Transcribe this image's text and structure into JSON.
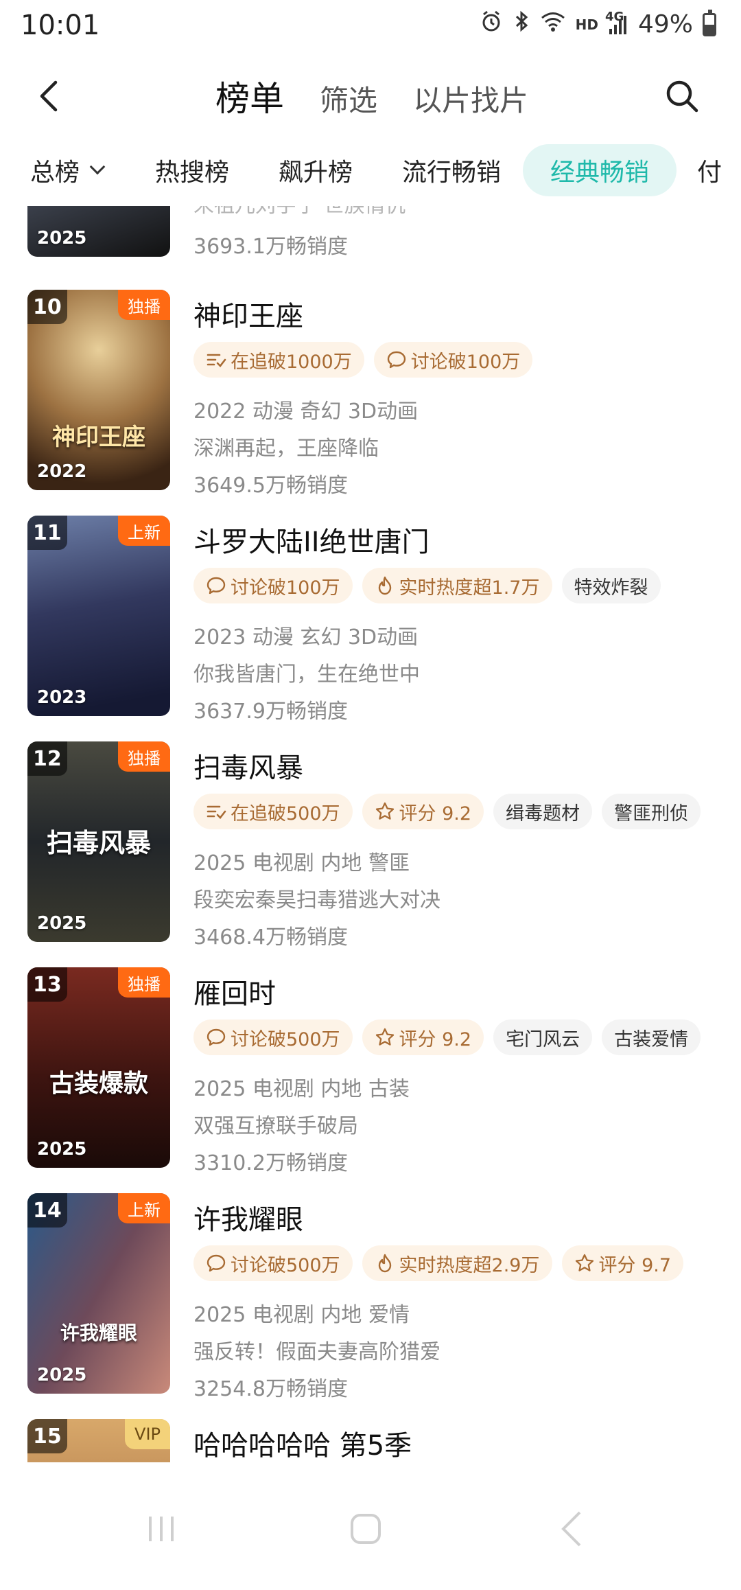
{
  "status": {
    "time": "10:01",
    "hd": "HD",
    "network": "4G",
    "battery": "49%",
    "battery_level": 0.49
  },
  "header": {
    "tabs": [
      "榜单",
      "筛选",
      "以片找片"
    ]
  },
  "categories": [
    "总榜",
    "热搜榜",
    "飙升榜",
    "流行畅销",
    "经典畅销",
    "付"
  ],
  "partial_top": {
    "year": "2025",
    "meta_cut": "宋祖儿刘宇宁 世族情仇",
    "sales": "3693.1万畅销度"
  },
  "items": [
    {
      "rank": "10",
      "badge": "独播",
      "year": "2022",
      "poster_text": "神印王座",
      "title": "神印王座",
      "tags": [
        {
          "icon": "list-check-icon",
          "text": "在追破1000万",
          "style": "hl"
        },
        {
          "icon": "chat-bubble-icon",
          "text": "讨论破100万",
          "style": "hl"
        }
      ],
      "meta": "2022 动漫 奇幻 3D动画",
      "desc": "深渊再起，王座降临",
      "sales": "3649.5万畅销度"
    },
    {
      "rank": "11",
      "badge": "上新",
      "year": "2023",
      "poster_text": "",
      "title": "斗罗大陆II绝世唐门",
      "tags": [
        {
          "icon": "chat-bubble-icon",
          "text": "讨论破100万",
          "style": "hl"
        },
        {
          "icon": "flame-icon",
          "text": "实时热度超1.7万",
          "style": "hl"
        },
        {
          "icon": "",
          "text": "特效炸裂",
          "style": "plain"
        }
      ],
      "meta": "2023 动漫 玄幻 3D动画",
      "desc": "你我皆唐门，生在绝世中",
      "sales": "3637.9万畅销度"
    },
    {
      "rank": "12",
      "badge": "独播",
      "year": "2025",
      "poster_text": "扫毒风暴",
      "title": "扫毒风暴",
      "tags": [
        {
          "icon": "list-check-icon",
          "text": "在追破500万",
          "style": "hl"
        },
        {
          "icon": "star-icon",
          "text": "评分 9.2",
          "style": "hl"
        },
        {
          "icon": "",
          "text": "缉毒题材",
          "style": "plain"
        },
        {
          "icon": "",
          "text": "警匪刑侦",
          "style": "plain"
        }
      ],
      "meta": "2025 电视剧 内地 警匪",
      "desc": "段奕宏秦昊扫毒猎逃大对决",
      "sales": "3468.4万畅销度"
    },
    {
      "rank": "13",
      "badge": "独播",
      "year": "2025",
      "poster_text": "古装爆款",
      "title": "雁回时",
      "tags": [
        {
          "icon": "chat-bubble-icon",
          "text": "讨论破500万",
          "style": "hl"
        },
        {
          "icon": "star-icon",
          "text": "评分 9.2",
          "style": "hl"
        },
        {
          "icon": "",
          "text": "宅门风云",
          "style": "plain"
        },
        {
          "icon": "",
          "text": "古装爱情",
          "style": "plain"
        }
      ],
      "meta": "2025 电视剧 内地 古装",
      "desc": "双强互撩联手破局",
      "sales": "3310.2万畅销度"
    },
    {
      "rank": "14",
      "badge": "上新",
      "year": "2025",
      "poster_text": "许我耀眼",
      "title": "许我耀眼",
      "tags": [
        {
          "icon": "chat-bubble-icon",
          "text": "讨论破500万",
          "style": "hl"
        },
        {
          "icon": "flame-icon",
          "text": "实时热度超2.9万",
          "style": "hl"
        },
        {
          "icon": "star-icon",
          "text": "评分 9.7",
          "style": "hl"
        }
      ],
      "meta": "2025 电视剧 内地 爱情",
      "desc": "强反转！假面夫妻高阶猎爱",
      "sales": "3254.8万畅销度"
    },
    {
      "rank": "15",
      "badge": "VIP",
      "year": "",
      "poster_text": "",
      "title": "哈哈哈哈哈 第5季",
      "tags": [],
      "meta": "",
      "desc": "",
      "sales": ""
    }
  ],
  "colors": {
    "accent": "#1fb9aa",
    "accent_bg": "#e3f6f4",
    "badge_orange": "#ff6a13",
    "badge_vip": "#f3d27a",
    "tag_bg": "#fdf3e7",
    "tag_text": "#a86b33"
  }
}
